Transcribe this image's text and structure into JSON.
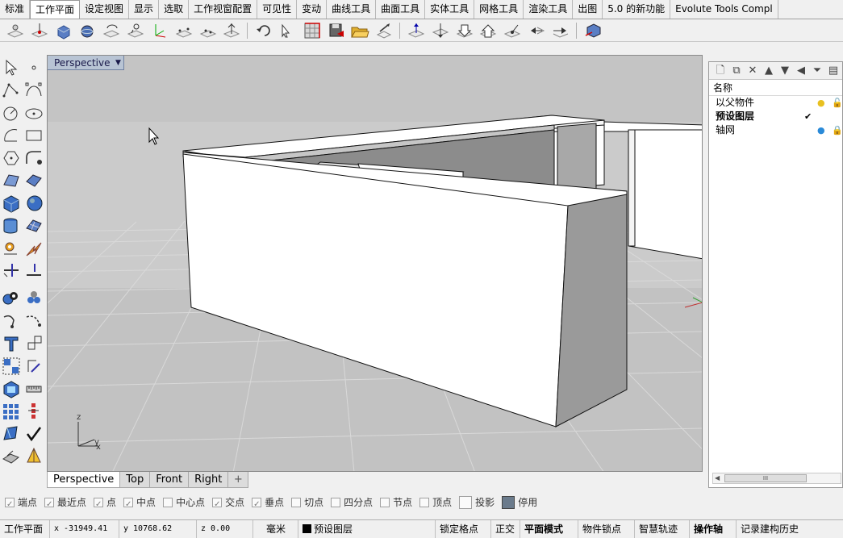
{
  "tabs": [
    "标准",
    "工作平面",
    "设定视图",
    "显示",
    "选取",
    "工作视窗配置",
    "可见性",
    "变动",
    "曲线工具",
    "曲面工具",
    "实体工具",
    "网格工具",
    "渲染工具",
    "出图",
    "5.0 的新功能",
    "Evolute Tools Compl"
  ],
  "active_tab_index": 1,
  "viewport": {
    "title": "Perspective",
    "menu_arrow": "▼",
    "axes": {
      "z": "z",
      "y": "y",
      "x": "x"
    }
  },
  "view_tabs": [
    "Perspective",
    "Top",
    "Front",
    "Right"
  ],
  "view_tab_add": "+",
  "layers_panel": {
    "header": "名称",
    "layers": [
      {
        "name": "以父物件",
        "current": false,
        "light": "bulb-on-yellow",
        "lock": "unlocked"
      },
      {
        "name": "预设图层",
        "current": true,
        "check": "✔"
      },
      {
        "name": "轴网",
        "current": false,
        "light": "bulb-on-blue",
        "lock": "locked"
      }
    ],
    "scroll_grip": "III"
  },
  "osnaps": [
    {
      "label": "端点",
      "checked": true
    },
    {
      "label": "最近点",
      "checked": true
    },
    {
      "label": "点",
      "checked": true
    },
    {
      "label": "中点",
      "checked": true
    },
    {
      "label": "中心点",
      "checked": false
    },
    {
      "label": "交点",
      "checked": true
    },
    {
      "label": "垂点",
      "checked": true
    },
    {
      "label": "切点",
      "checked": false
    },
    {
      "label": "四分点",
      "checked": false
    },
    {
      "label": "节点",
      "checked": false
    },
    {
      "label": "顶点",
      "checked": false
    },
    {
      "label": "投影",
      "checked": false
    },
    {
      "label": "停用",
      "checked": true
    }
  ],
  "status": {
    "cplane": "工作平面",
    "x": "x -31949.41",
    "y": "y 10768.62",
    "z": "z 0.00",
    "units": "毫米",
    "layer": "预设图层",
    "buttons": [
      {
        "label": "锁定格点",
        "bold": false
      },
      {
        "label": "正交",
        "bold": false
      },
      {
        "label": "平面模式",
        "bold": true
      },
      {
        "label": "物件锁点",
        "bold": false
      },
      {
        "label": "智慧轨迹",
        "bold": false
      },
      {
        "label": "操作轴",
        "bold": true
      },
      {
        "label": "记录建构历史",
        "bold": false
      }
    ]
  }
}
